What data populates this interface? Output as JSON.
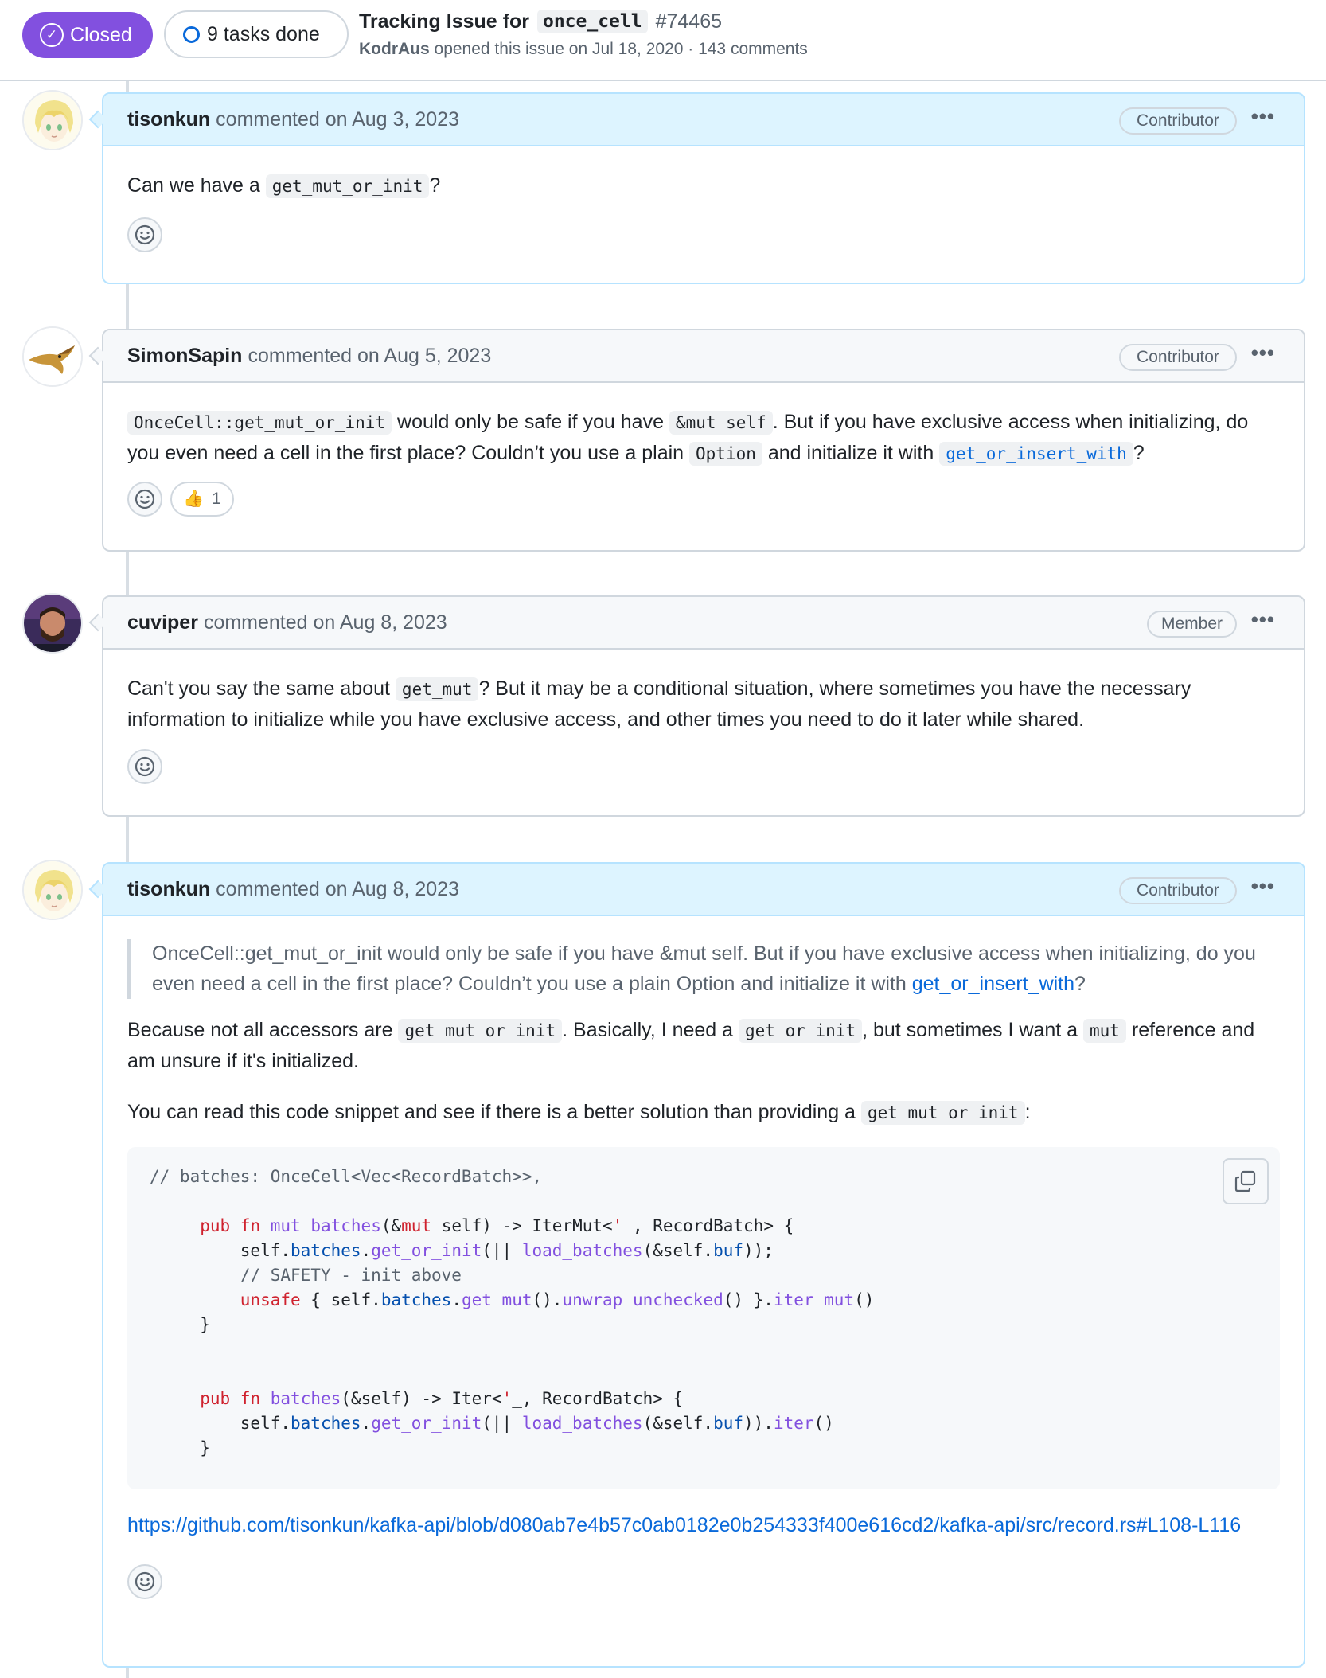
{
  "issue": {
    "state_label": "Closed",
    "tasks_label": "9 tasks done",
    "title_prefix": "Tracking Issue for",
    "title_code": "once_cell",
    "number": "#74465",
    "meta_author": "KodrAus",
    "meta_text": "opened this issue on Jul 18, 2020 · 143 comments",
    "colors": {
      "closed_purple": "#8250df",
      "link_blue": "#0969da",
      "own_header": "#ddf4ff"
    }
  },
  "comments": [
    {
      "author": "tisonkun",
      "date_text": "commented on Aug 3, 2023",
      "role": "Contributor",
      "body": {
        "t1": "Can we have a",
        "c1": "get_mut_or_init",
        "t2": "?"
      },
      "avatar_icon": "anime-avatar-icon"
    },
    {
      "author": "SimonSapin",
      "date_text": "commented on Aug 5, 2023",
      "role": "Contributor",
      "body": {
        "c1": "OnceCell::get_mut_or_init",
        "t1": "would only be safe if you have",
        "c2": "&mut self",
        "t2": ". But if you have exclusive access when initializing, do you even need a cell in the first place? Couldn’t you use a plain",
        "c3": "Option",
        "t3": "and initialize it with",
        "c4": "get_or_insert_with",
        "t4": "?"
      },
      "reaction": {
        "icon": "thumbs-up-icon",
        "glyph": "👍",
        "count": "1"
      },
      "avatar_icon": "bird-avatar-icon"
    },
    {
      "author": "cuviper",
      "date_text": "commented on Aug 8, 2023",
      "role": "Member",
      "body": {
        "t1": "Can't you say the same about",
        "c1": "get_mut",
        "t2": "? But it may be a conditional situation, where sometimes you have the necessary information to initialize while you have exclusive access, and other times you need to do it later while shared."
      },
      "avatar_icon": "photo-avatar-icon"
    },
    {
      "author": "tisonkun",
      "date_text": "commented on Aug 8, 2023",
      "role": "Contributor",
      "quote": {
        "text": "OnceCell::get_mut_or_init would only be safe if you have &mut self. But if you have exclusive access when initializing, do you even need a cell in the first place? Couldn’t you use a plain Option and initialize it with",
        "link": "get_or_insert_with",
        "end": "?"
      },
      "p1": {
        "t1": "Because not all accessors are",
        "c1": "get_mut_or_init",
        "t2": ". Basically, I need a",
        "c2": "get_or_init",
        "t3": ", but sometimes I want a",
        "c3": "mut",
        "t4": "reference and am unsure if it's initialized."
      },
      "p2": {
        "t1": "You can read this code snippet and see if there is a better solution than providing a",
        "c1": "get_mut_or_init",
        "t2": ":"
      },
      "code": {
        "line1": "// batches: OnceCell<Vec<RecordBatch>>,",
        "line2": "pub fn mut_batches(&mut self) -> IterMut<'_, RecordBatch> {",
        "line3": "self.batches.get_or_init(|| load_batches(&self.buf));",
        "line4": "// SAFETY - init above",
        "line5": "unsafe { self.batches.get_mut().unwrap_unchecked() }.iter_mut()",
        "line6": "}",
        "line7": "pub fn batches(&self) -> Iter<'_, RecordBatch> {",
        "line8": "self.batches.get_or_init(|| load_batches(&self.buf)).iter()",
        "line9": "}"
      },
      "link": "https://github.com/tisonkun/kafka-api/blob/d080ab7e4b57c0ab0182e0b254333f400e616cd2/kafka-api/src/record.rs#L108-L116",
      "avatar_icon": "anime-avatar-icon"
    }
  ]
}
